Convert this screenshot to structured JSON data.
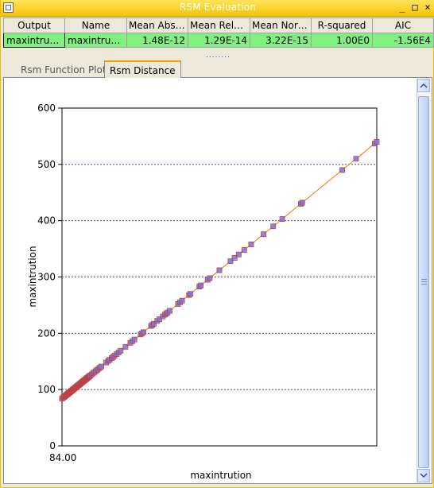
{
  "window": {
    "title": "RSM Evaluation"
  },
  "window_buttons": {
    "minimize": "_",
    "maximize": "□",
    "close": "×"
  },
  "table": {
    "headers": [
      "Output",
      "Name",
      "Mean Absol...",
      "Mean Relati...",
      "Mean Norm...",
      "R-squared",
      "AIC"
    ],
    "row": [
      "maxintruti...",
      "maxintruti...",
      "1.48E-12",
      "1.29E-14",
      "3.22E-15",
      "1.00E0",
      "-1.56E4"
    ]
  },
  "splitter_dots": "........",
  "tabs": [
    {
      "label": "Rsm Function Plot",
      "active": false
    },
    {
      "label": "Rsm Distance",
      "active": true
    }
  ],
  "chart_data": {
    "type": "scatter",
    "title": "",
    "xlabel": "maxintrution",
    "ylabel": "maxintrution",
    "x_tick_label": "84.00",
    "ylim": [
      0,
      600
    ],
    "xlim": [
      84,
      540
    ],
    "yticks": [
      0,
      100,
      200,
      300,
      400,
      500,
      600
    ],
    "grid": "horizontal dotted",
    "points": [
      84,
      86,
      87,
      88,
      89,
      90,
      91,
      92,
      93,
      94,
      95,
      96,
      97,
      98,
      99,
      100,
      101,
      102,
      103,
      104,
      105,
      106,
      107,
      108,
      109,
      110,
      111,
      112,
      113,
      114,
      115,
      116,
      117,
      118,
      119,
      120,
      121,
      122,
      123,
      124,
      125,
      127,
      129,
      131,
      133,
      135,
      137,
      139,
      141,
      148,
      151,
      153,
      156,
      158,
      160,
      163,
      166,
      169,
      176,
      183,
      186,
      189,
      198,
      200,
      202,
      213,
      215,
      217,
      222,
      225,
      230,
      233,
      235,
      237,
      240,
      252,
      255,
      258,
      268,
      270,
      283,
      285,
      295,
      298,
      312,
      328,
      334,
      340,
      348,
      358,
      376,
      390,
      403,
      430,
      432,
      490,
      510,
      537,
      540
    ],
    "fit_line": [
      [
        84,
        84
      ],
      [
        540,
        540
      ]
    ],
    "colors": {
      "point": "#6a7cf0",
      "marker_outline": "#c04040",
      "fit_line": "#f07010"
    }
  }
}
